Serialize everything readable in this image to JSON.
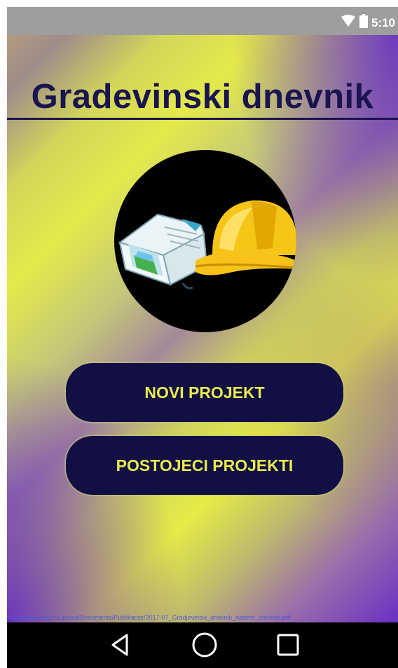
{
  "status_bar": {
    "time": "5:10",
    "icons": [
      "wifi-icon",
      "battery-icon"
    ]
  },
  "app": {
    "title": "Gradevinski dnevnik",
    "logo": "book-and-hardhat-logo",
    "buttons": {
      "new_project": "NOVI PROJEKT",
      "existing_projects": "POSTOJECI PROJEKTI"
    },
    "source_link": "http://www.hkis.hr/Upload/Documents/Publikacije/2017-07_Gradjevinski_dnevnik_nadzor_dnevnik.pdf",
    "colors": {
      "title": "#1a1450",
      "button_bg": "#120f45",
      "button_text": "#e9ec4a"
    }
  },
  "nav_bar": {
    "items": [
      "back-icon",
      "home-icon",
      "recent-apps-icon"
    ]
  }
}
